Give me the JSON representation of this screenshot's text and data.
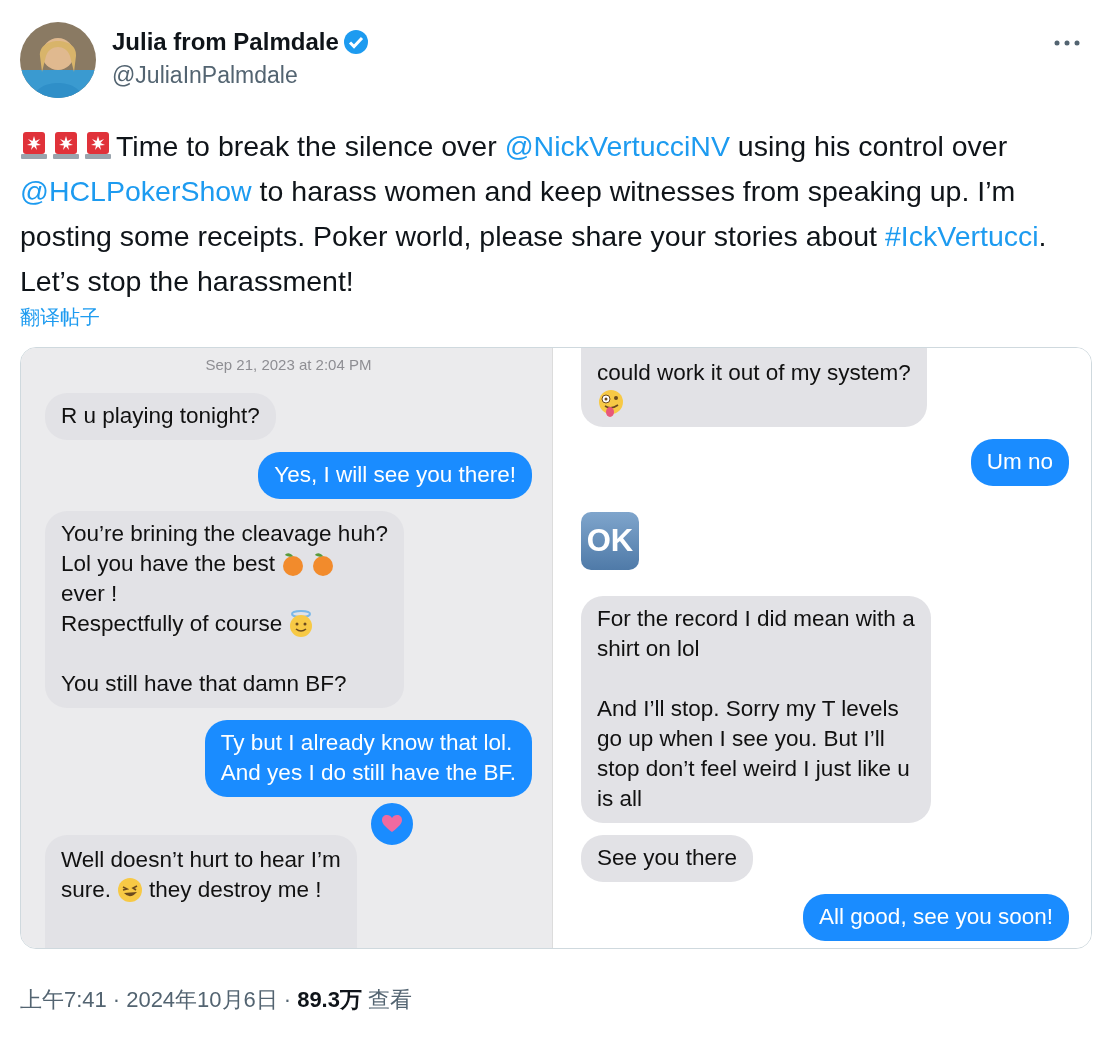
{
  "author": {
    "name": "Julia from Palmdale",
    "verified": true,
    "handle": "@JuliaInPalmdale"
  },
  "tweet": {
    "segments": [
      {
        "kind": "siren"
      },
      {
        "kind": "siren"
      },
      {
        "kind": "siren"
      },
      {
        "kind": "text",
        "text": "Time to break the silence over "
      },
      {
        "kind": "mention",
        "text": "@NickVertucciNV"
      },
      {
        "kind": "text",
        "text": " using his control over "
      },
      {
        "kind": "mention",
        "text": "@HCLPokerShow"
      },
      {
        "kind": "text",
        "text": " to harass women and keep witnesses from speaking up. I’m posting some receipts. Poker world, please share your stories about "
      },
      {
        "kind": "hashtag",
        "text": "#IckVertucci"
      },
      {
        "kind": "text",
        "text": ". Let’s stop the harassment!"
      }
    ],
    "translate_link": "翻译帖子"
  },
  "media": [
    {
      "timestamp": "Sep 21, 2023 at 2:04 PM",
      "messages": [
        {
          "kind": "bubble",
          "outgoing": false,
          "clipped_top": false,
          "clipped_bottom": false,
          "paragraphs": [
            [
              [
                {
                  "kind": "text",
                  "text": "R u playing tonight?"
                }
              ]
            ]
          ]
        },
        {
          "kind": "bubble",
          "outgoing": true,
          "clipped_top": false,
          "clipped_bottom": false,
          "paragraphs": [
            [
              [
                {
                  "kind": "text",
                  "text": "Yes, I will see you there!"
                }
              ]
            ]
          ]
        },
        {
          "kind": "bubble",
          "outgoing": false,
          "clipped_top": false,
          "clipped_bottom": false,
          "paragraphs": [
            [
              [
                {
                  "kind": "text",
                  "text": "You’re brining the cleavage huh?"
                }
              ],
              [
                {
                  "kind": "text",
                  "text": "Lol you have the best"
                },
                {
                  "kind": "peach"
                },
                {
                  "kind": "peach"
                }
              ],
              [
                {
                  "kind": "text",
                  "text": "ever !"
                }
              ],
              [
                {
                  "kind": "text",
                  "text": "Respectfully of course"
                },
                {
                  "kind": "halo"
                }
              ]
            ],
            [
              [
                {
                  "kind": "text",
                  "text": "You still have that damn BF?"
                }
              ]
            ]
          ]
        },
        {
          "kind": "bubble",
          "outgoing": true,
          "clipped_top": false,
          "clipped_bottom": false,
          "paragraphs": [
            [
              [
                {
                  "kind": "text",
                  "text": "Ty but I already know that lol."
                }
              ],
              [
                {
                  "kind": "text",
                  "text": "And yes I do still have the BF."
                }
              ]
            ]
          ]
        },
        {
          "kind": "bubble",
          "outgoing": false,
          "tapback": true,
          "clipped_top": false,
          "clipped_bottom": true,
          "paragraphs": [
            [
              [
                {
                  "kind": "text",
                  "text": "Well doesn’t hurt to hear I’m"
                }
              ],
              [
                {
                  "kind": "text",
                  "text": "sure."
                },
                {
                  "kind": "laugh"
                },
                {
                  "kind": "text",
                  "text": "they destroy me !"
                }
              ]
            ]
          ]
        }
      ]
    },
    {
      "messages": [
        {
          "kind": "bubble",
          "outgoing": false,
          "clipped_top": true,
          "clipped_bottom": false,
          "paragraphs": [
            [
              [
                {
                  "kind": "text",
                  "text": "could work it out of my system?"
                }
              ],
              [
                {
                  "kind": "zany"
                }
              ]
            ]
          ]
        },
        {
          "kind": "bubble",
          "outgoing": true,
          "clipped_top": false,
          "clipped_bottom": false,
          "paragraphs": [
            [
              [
                {
                  "kind": "text",
                  "text": "Um no"
                }
              ]
            ]
          ]
        },
        {
          "kind": "emoji",
          "outgoing": false,
          "clipped_top": false,
          "clipped_bottom": false,
          "paragraphs": [
            [
              [
                {
                  "kind": "ok",
                  "text": "OK"
                }
              ]
            ]
          ]
        },
        {
          "kind": "bubble",
          "outgoing": false,
          "clipped_top": false,
          "clipped_bottom": false,
          "paragraphs": [
            [
              [
                {
                  "kind": "text",
                  "text": "For the record I did mean with a"
                }
              ],
              [
                {
                  "kind": "text",
                  "text": "shirt on lol"
                }
              ]
            ],
            [
              [
                {
                  "kind": "text",
                  "text": "And I’ll stop. Sorry my T levels"
                }
              ],
              [
                {
                  "kind": "text",
                  "text": "go up when I see you. But I’ll"
                }
              ],
              [
                {
                  "kind": "text",
                  "text": "stop don’t feel weird I just like u"
                }
              ],
              [
                {
                  "kind": "text",
                  "text": "is all"
                }
              ]
            ]
          ]
        },
        {
          "kind": "bubble",
          "outgoing": false,
          "clipped_top": false,
          "clipped_bottom": false,
          "paragraphs": [
            [
              [
                {
                  "kind": "text",
                  "text": "See you there"
                }
              ]
            ]
          ]
        },
        {
          "kind": "bubble",
          "outgoing": true,
          "clipped_top": false,
          "clipped_bottom": false,
          "paragraphs": [
            [
              [
                {
                  "kind": "text",
                  "text": "All good, see you soon!"
                }
              ]
            ]
          ]
        }
      ]
    }
  ],
  "footer": [
    {
      "kind": "text",
      "text": "上午7:41"
    },
    {
      "kind": "separator",
      "text": "·"
    },
    {
      "kind": "text",
      "text": "2024年10月6日"
    },
    {
      "kind": "separator",
      "text": "·"
    },
    {
      "kind": "bold",
      "text": "89.3万"
    },
    {
      "kind": "text",
      "text": "查看"
    }
  ]
}
